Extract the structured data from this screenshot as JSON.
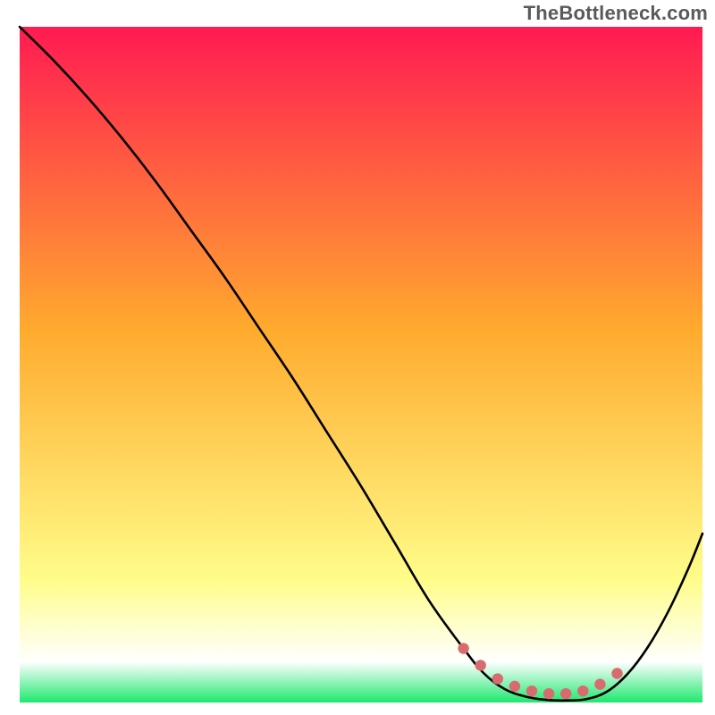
{
  "watermark": "TheBottleneck.com",
  "colors": {
    "grad_top": "#ff1a52",
    "grad_mid": "#ffab2e",
    "grad_low": "#fffd8a",
    "grad_white": "#ffffff",
    "grad_green": "#1ee86e",
    "curve": "#000000",
    "dots": "#d96a70"
  },
  "chart_data": {
    "type": "line",
    "title": "",
    "xlabel": "",
    "ylabel": "",
    "xlim": [
      0,
      100
    ],
    "ylim": [
      0,
      100
    ],
    "curve": {
      "name": "bottleneck-curve",
      "x": [
        0,
        5,
        10,
        15,
        20,
        25,
        30,
        35,
        40,
        45,
        50,
        55,
        60,
        65,
        68,
        71,
        74,
        77,
        80,
        83,
        86,
        89,
        92,
        95,
        98,
        100
      ],
      "y": [
        100,
        95,
        89.5,
        83.5,
        77,
        70,
        63,
        55.5,
        48,
        40,
        32,
        23.5,
        15,
        8,
        4.3,
        2,
        0.9,
        0.4,
        0.3,
        0.5,
        1.6,
        4.2,
        8.2,
        13.5,
        20,
        25
      ]
    },
    "dots": {
      "name": "highlight-dots",
      "x": [
        65,
        67.5,
        70,
        72.5,
        75,
        77.5,
        80,
        82.5,
        85,
        87.5
      ],
      "y": [
        8,
        5.5,
        3.5,
        2.4,
        1.7,
        1.3,
        1.3,
        1.7,
        2.7,
        4.3
      ]
    },
    "gradient_stops": [
      {
        "offset": 0.0,
        "color": "#ff1a52"
      },
      {
        "offset": 0.45,
        "color": "#ffab2e"
      },
      {
        "offset": 0.82,
        "color": "#fffd8a"
      },
      {
        "offset": 0.94,
        "color": "#ffffff"
      },
      {
        "offset": 1.0,
        "color": "#1ee86e"
      }
    ]
  }
}
